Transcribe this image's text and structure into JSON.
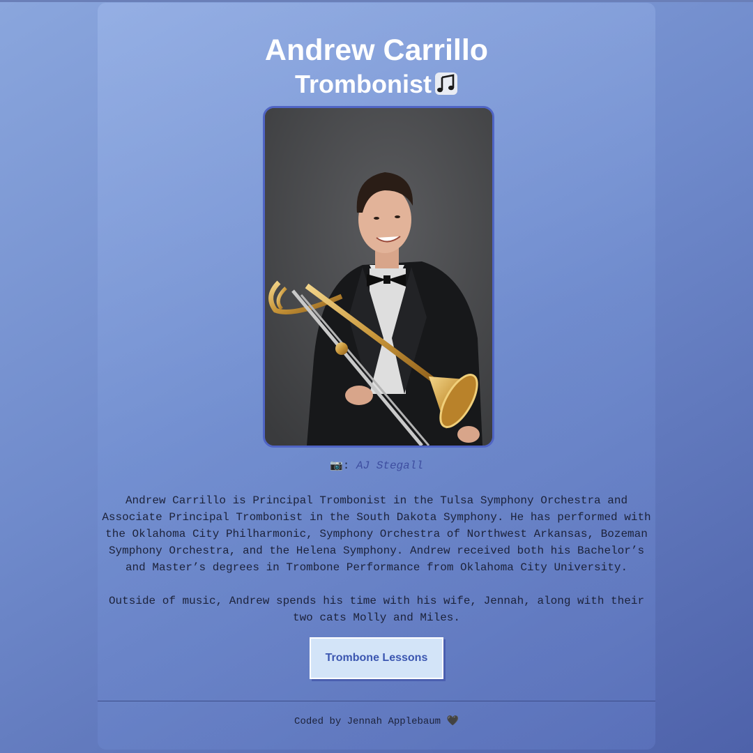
{
  "header": {
    "name": "Andrew Carrillo",
    "role": "Trombonist",
    "role_icon": "music-note-icon"
  },
  "photo": {
    "description_icon": "portrait-photo",
    "credit_icon": "camera-icon",
    "credit_label": ":",
    "credit_name": "AJ Stegall"
  },
  "bio": {
    "paragraph_1": "Andrew Carrillo is Principal Trombonist in the Tulsa Symphony Orchestra and Associate Principal Trombonist in the South Dakota Symphony. He has performed with the Oklahoma City Philharmonic, Symphony Orchestra of Northwest Arkansas, Bozeman Symphony Orchestra, and the Helena Symphony. Andrew received both his Bachelor’s and Master’s degrees in Trombone Performance from Oklahoma City University.",
    "paragraph_2": "Outside of music, Andrew spends his time with his wife, Jennah, along with their two cats Molly and Miles."
  },
  "cta": {
    "lessons_label": "Trombone Lessons"
  },
  "footer": {
    "credit": "Coded by Jennah Applebaum",
    "heart_icon": "black-heart-icon"
  },
  "colors": {
    "background": "#6f8acb",
    "accent_border": "#4f64c4",
    "button_bg": "#d3e4f8",
    "button_text": "#3b56b0",
    "link": "#3e4ea0"
  }
}
